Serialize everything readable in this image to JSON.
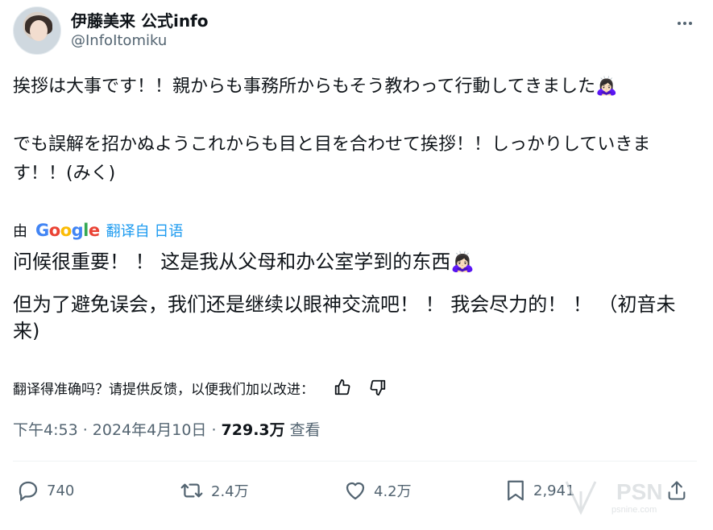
{
  "author": {
    "display_name": "伊藤美来 公式info",
    "handle": "@InfoItomiku"
  },
  "tweet": {
    "original_lines": [
      "挨拶は大事です！！親からも事務所からもそう教わって行動してきました🙇🏻‍♀️",
      "",
      "でも誤解を招かぬようこれからも目と目を合わせて挨拶！！しっかりしていきます！！(みく)"
    ],
    "translated_by_prefix": "由",
    "translated_by_brand": "Google",
    "translated_from": "翻译自 日语",
    "translation": [
      "问候很重要！ ！ 这是我从父母和办公室学到的东西🙇🏻‍♀️",
      "但为了避免误会，我们还是继续以眼神交流吧！ ！ 我会尽力的！ ！ （初音未来)"
    ],
    "feedback_prompt": "翻译得准确吗？请提供反馈，以便我们加以改进："
  },
  "meta": {
    "time_date": "下午4:53 · 2024年4月10日 · ",
    "views_count": "729.3万",
    "views_label": " 查看"
  },
  "actions": {
    "replies": "740",
    "retweets": "2.4万",
    "likes": "4.2万",
    "bookmarks": "2,941"
  },
  "icons": {
    "more": "more-icon",
    "thumbs_up": "thumbs-up-icon",
    "thumbs_down": "thumbs-down-icon",
    "reply": "reply-icon",
    "retweet": "retweet-icon",
    "like": "heart-icon",
    "bookmark": "bookmark-icon",
    "share": "share-icon"
  },
  "watermark": {
    "brand": "PSN",
    "url": "psnine.com"
  },
  "colors": {
    "text": "#0f1419",
    "secondary": "#536471",
    "link": "#1d9bf0"
  }
}
